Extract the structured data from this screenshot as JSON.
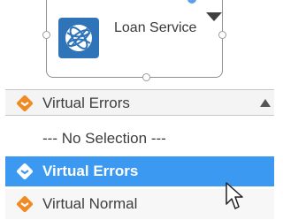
{
  "node": {
    "label": "Loan Service",
    "icon": "globe-icon",
    "icon_color": "#2f74b8"
  },
  "dropdown": {
    "current_label": "Virtual Errors",
    "current_icon": "virtual-errors-icon",
    "scroll_icon": "scroll-up-icon",
    "options": [
      {
        "label": "--- No Selection ---",
        "icon": ""
      },
      {
        "label": "Virtual Errors",
        "icon": "virtual-errors-icon",
        "selected": true
      },
      {
        "label": "Virtual Normal",
        "icon": "virtual-normal-icon"
      }
    ],
    "selected_color": "#3b99f2",
    "icon_color": "#f08a24"
  },
  "cursor": {
    "icon": "mouse-pointer-icon"
  }
}
